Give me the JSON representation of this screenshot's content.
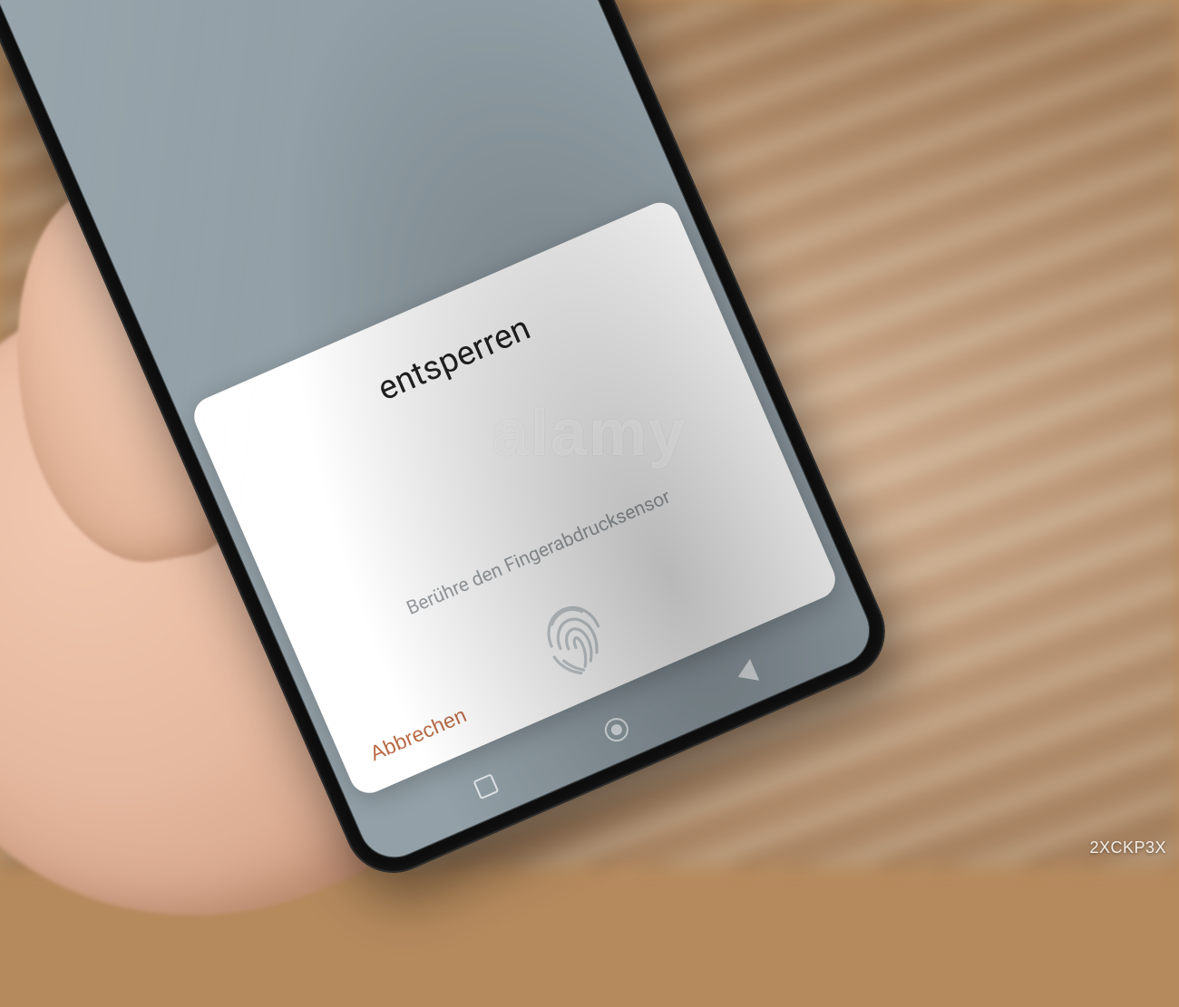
{
  "dialog": {
    "title": "entsperren",
    "instruction": "Berühre den Fingerabdrucksensor",
    "cancel_label": "Abbrechen"
  },
  "icons": {
    "fingerprint": "fingerprint-icon",
    "nav_recent": "recent-apps-icon",
    "nav_home": "home-icon",
    "nav_back": "back-icon"
  },
  "watermark": {
    "text": "alamy",
    "image_id": "2XCKP3X"
  }
}
